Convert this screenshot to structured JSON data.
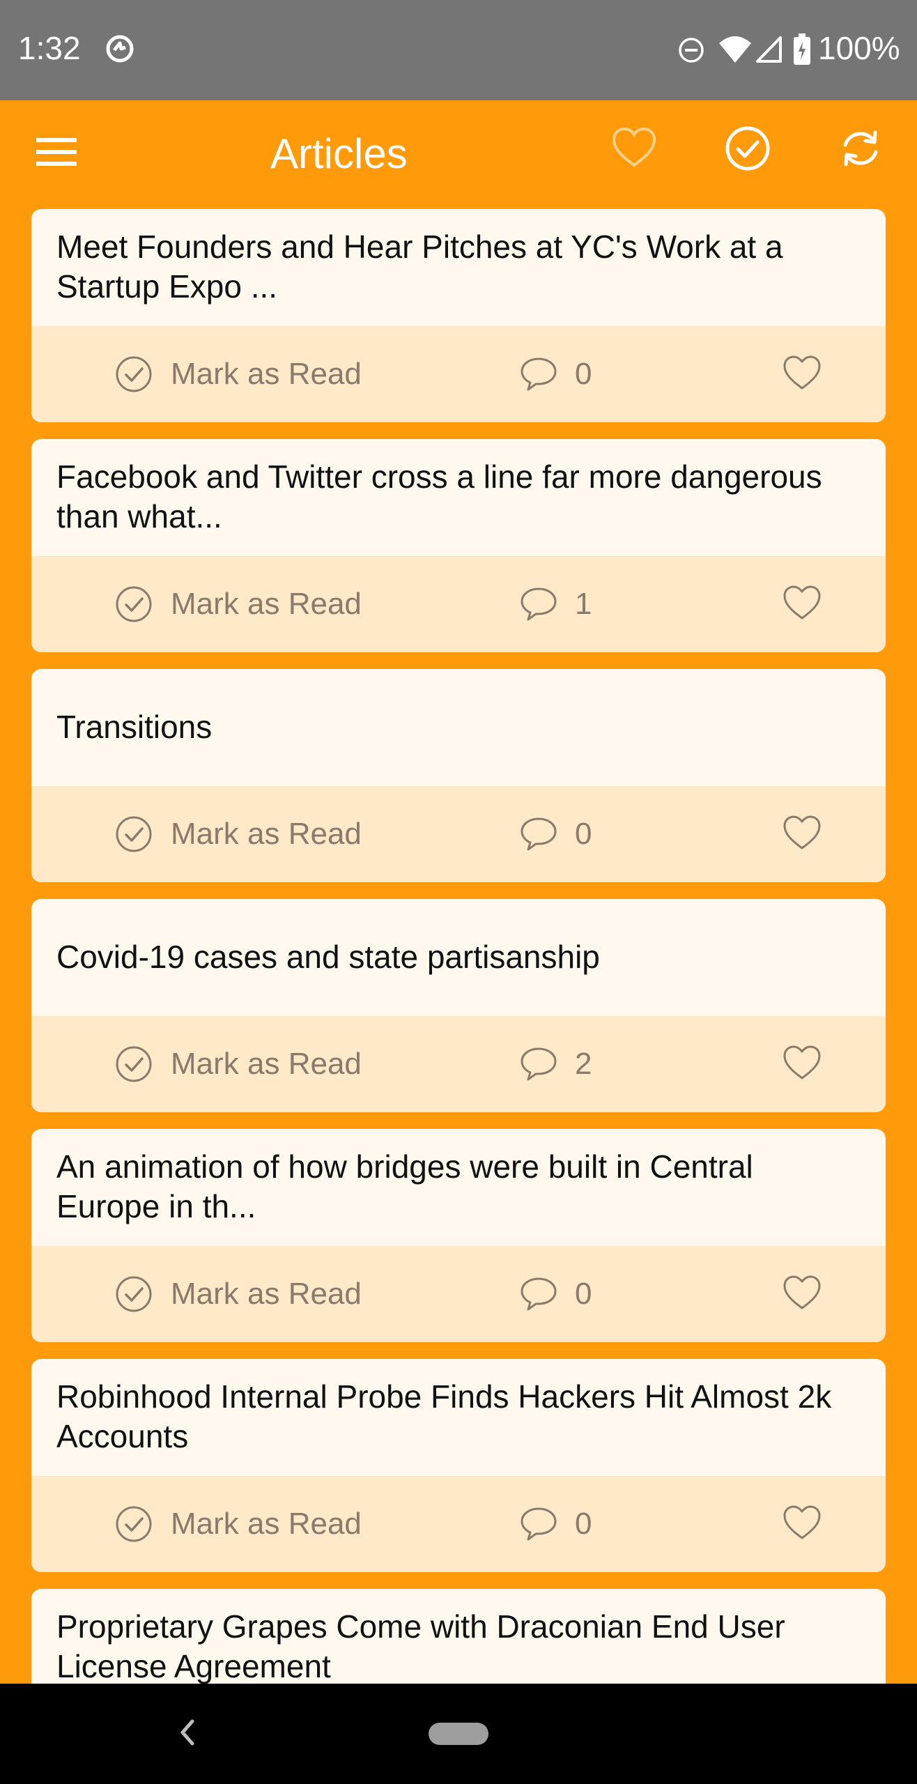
{
  "status_bar": {
    "time": "1:32",
    "battery": "100%",
    "icons": [
      "sync-icon",
      "do-not-disturb-icon",
      "wifi-icon",
      "signal-icon",
      "battery-charging-icon"
    ]
  },
  "app_bar": {
    "title": "Articles",
    "icons": [
      "menu-icon",
      "heart-icon",
      "check-circle-icon",
      "refresh-icon"
    ]
  },
  "actions": {
    "mark_read_label": "Mark as Read"
  },
  "articles": [
    {
      "title": "Meet Founders and Hear Pitches at YC's Work at a Startup Expo ...",
      "comments": "0"
    },
    {
      "title": "Facebook and Twitter cross a line far more dangerous than what...",
      "comments": "1"
    },
    {
      "title": "Transitions",
      "comments": "0"
    },
    {
      "title": "Covid-19 cases and state partisanship",
      "comments": "2"
    },
    {
      "title": "An animation of how bridges were built in Central Europe in th...",
      "comments": "0"
    },
    {
      "title": "Robinhood Internal Probe Finds Hackers Hit Almost 2k Accounts",
      "comments": "0"
    },
    {
      "title": "Proprietary Grapes Come with Draconian End User License Agreement",
      "comments": ""
    }
  ],
  "colors": {
    "accent": "#FF9A0A",
    "status_bar": "#757575",
    "card_top": "#FFF8EE",
    "card_actions": "#FFE9C9",
    "muted_text": "#8a7a6a"
  }
}
